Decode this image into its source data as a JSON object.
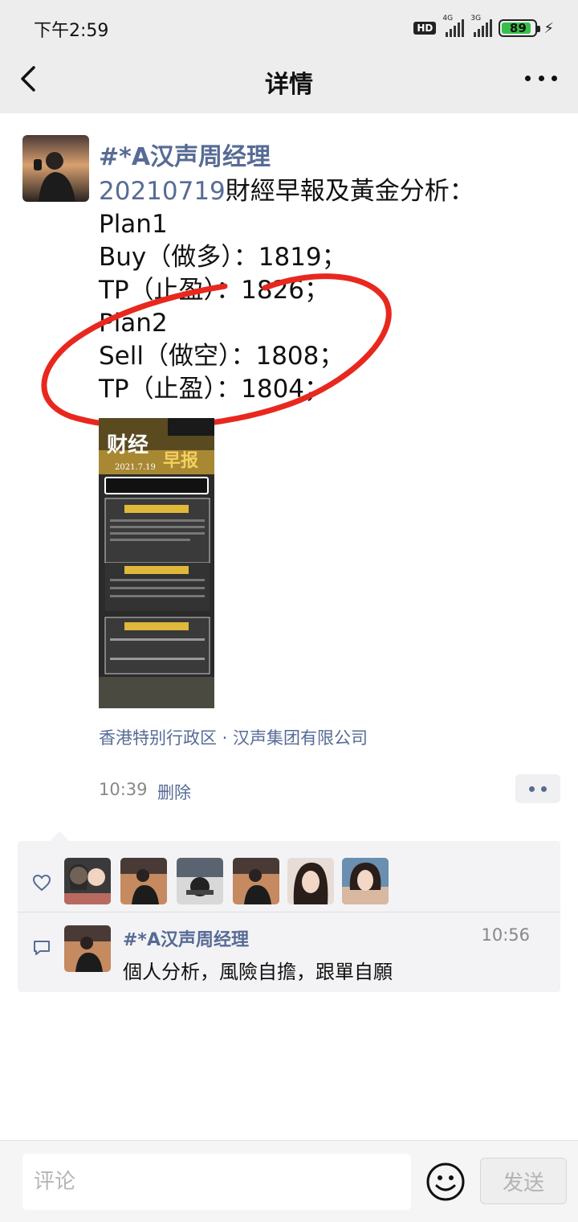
{
  "status_bar": {
    "time": "下午2:59",
    "hd": "HD",
    "network1": "4G",
    "network2": "3G",
    "battery_level": "89",
    "battery_color": "#36c04a"
  },
  "nav": {
    "title": "详情",
    "back_icon": "chevron-left-icon",
    "more_icon": "more-icon"
  },
  "post": {
    "author": "#*A汉声周经理",
    "date_link": "20210719",
    "lines": [
      "財經早報及黃金分析：",
      "Plan1",
      "Buy（做多）：1819；",
      "TP（止盈）：1826；",
      "Plan2",
      "Sell（做空）：1808；",
      "TP（止盈）：1804；"
    ],
    "location": "香港特别行政区 · 汉声集团有限公司",
    "time": "10:39",
    "delete_label": "删除",
    "link_color": "#576b95"
  },
  "likes": {
    "icon": "heart-icon",
    "count": 6
  },
  "comment": {
    "icon": "comment-icon",
    "author": "#*A汉声周经理",
    "time": "10:56",
    "text": "個人分析，風險自擔，跟單自願"
  },
  "bottom": {
    "placeholder": "评论",
    "send_label": "发送",
    "emoji_icon": "smiley-icon"
  }
}
